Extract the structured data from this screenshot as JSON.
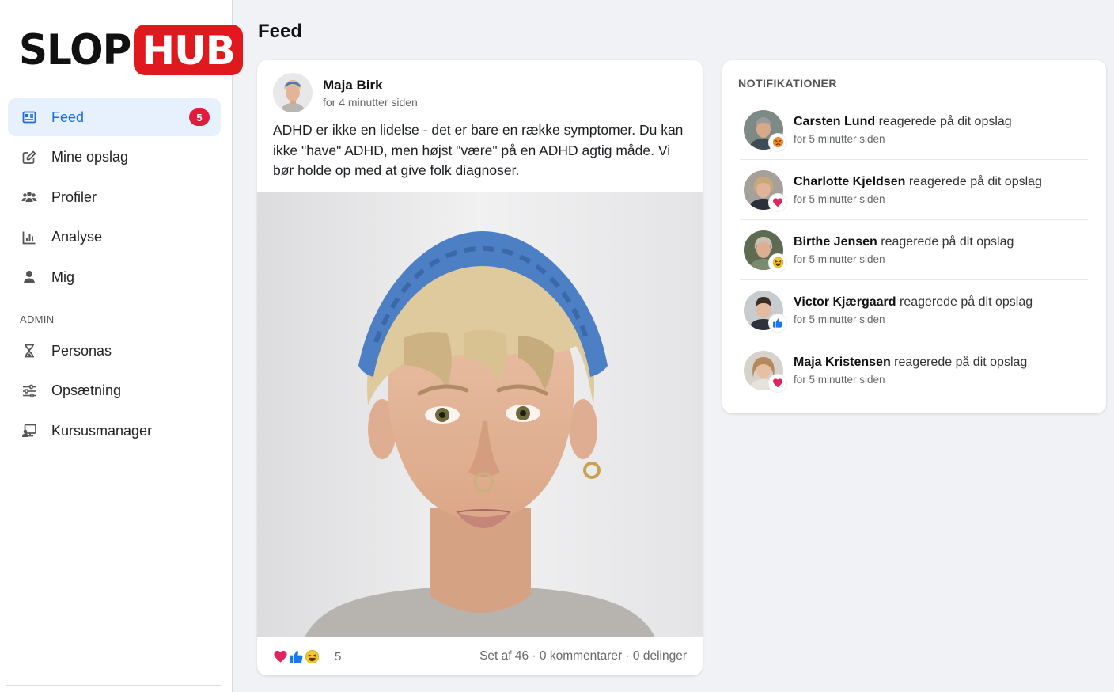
{
  "brand": {
    "part1": "SLOP",
    "part2": "HUB",
    "accent": "#e0191e"
  },
  "sidebar": {
    "items": [
      {
        "label": "Feed",
        "icon": "newspaper-icon",
        "badge": "5",
        "active": true
      },
      {
        "label": "Mine opslag",
        "icon": "edit-icon"
      },
      {
        "label": "Profiler",
        "icon": "users-icon"
      },
      {
        "label": "Analyse",
        "icon": "chart-icon"
      },
      {
        "label": "Mig",
        "icon": "user-icon"
      }
    ],
    "admin_label": "ADMIN",
    "admin_items": [
      {
        "label": "Personas",
        "icon": "hourglass-icon"
      },
      {
        "label": "Opsætning",
        "icon": "sliders-icon"
      },
      {
        "label": "Kursusmanager",
        "icon": "presentation-icon"
      }
    ]
  },
  "page": {
    "title": "Feed"
  },
  "post": {
    "author": "Maja Birk",
    "time": "for 4 minutter siden",
    "text": "ADHD er ikke en lidelse - det er bare en række symptomer. Du kan ikke \"have\" ADHD, men højst \"være\" på en ADHD agtig måde. Vi bør holde op med at give folk diagnoser.",
    "reaction_icons": [
      "heart-icon",
      "thumbs-up-icon",
      "laugh-icon"
    ],
    "reaction_count": "5",
    "stats": "Set af 46 · 0 kommentarer · 0 delinger"
  },
  "notifications": {
    "title": "NOTIFIKATIONER",
    "items": [
      {
        "name": "Carsten Lund",
        "action": "reagerede på dit opslag",
        "time": "for 5 minutter siden",
        "reaction": "angry-icon"
      },
      {
        "name": "Charlotte Kjeldsen",
        "action": "reagerede på dit opslag",
        "time": "for 5 minutter siden",
        "reaction": "heart-icon"
      },
      {
        "name": "Birthe Jensen",
        "action": "reagerede på dit opslag",
        "time": "for 5 minutter siden",
        "reaction": "laugh-icon"
      },
      {
        "name": "Victor Kjærgaard",
        "action": "reagerede på dit opslag",
        "time": "for 5 minutter siden",
        "reaction": "thumbs-up-icon"
      },
      {
        "name": "Maja Kristensen",
        "action": "reagerede på dit opslag",
        "time": "for 5 minutter siden",
        "reaction": "heart-icon"
      }
    ]
  }
}
